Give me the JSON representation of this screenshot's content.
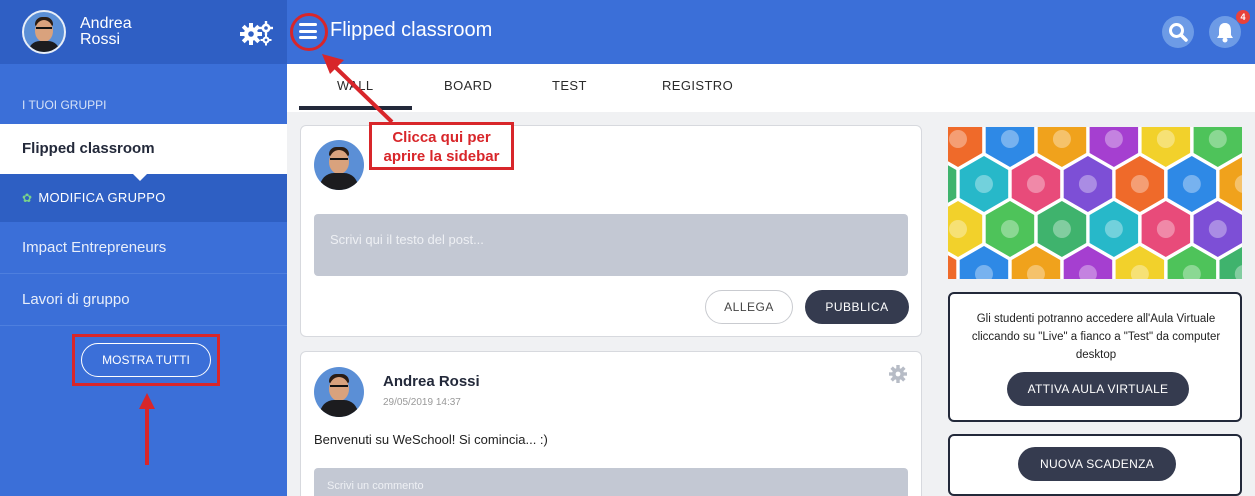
{
  "sidebar": {
    "user_name": "Andrea\nRossi",
    "section_label": "I TUOI GRUPPI",
    "current_group": "Flipped classroom",
    "edit_group": "MODIFICA GRUPPO",
    "items": [
      {
        "label": "Impact Entrepreneurs"
      },
      {
        "label": "Lavori di gruppo"
      }
    ],
    "show_all": "MOSTRA TUTTI"
  },
  "topbar": {
    "title": "Flipped classroom",
    "notification_count": "4"
  },
  "tabs": [
    {
      "label": "WALL",
      "active": true
    },
    {
      "label": "BOARD"
    },
    {
      "label": "TEST"
    },
    {
      "label": "REGISTRO"
    }
  ],
  "annotation": {
    "line1": "Clicca qui per",
    "line2": "aprire la sidebar"
  },
  "composer": {
    "placeholder": "Scrivi qui il testo del post...",
    "attach_label": "ALLEGA",
    "publish_label": "PUBBLICA"
  },
  "post": {
    "author": "Andrea Rossi",
    "date": "29/05/2019 14:37",
    "text": "Benvenuti su WeSchool! Si comincia... :)",
    "comment_placeholder": "Scrivi un commento"
  },
  "info_card": {
    "text": "Gli studenti potranno accedere all'Aula Virtuale cliccando su \"Live\" a fianco a \"Test\" da computer desktop",
    "button": "ATTIVA AULA VIRTUALE"
  },
  "deadline_card": {
    "button": "NUOVA SCADENZA"
  },
  "colors": {
    "brand_blue": "#3b6fd8",
    "dark_button": "#353b4f",
    "annotation_red": "#d8262a"
  }
}
